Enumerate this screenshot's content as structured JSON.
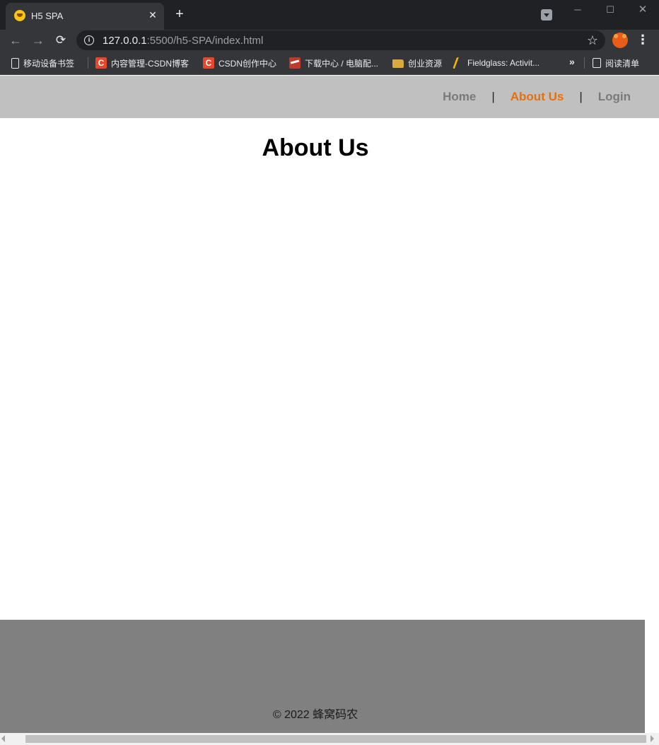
{
  "browser": {
    "tab_title": "H5 SPA",
    "tab_close": "✕",
    "new_tab": "+",
    "window_controls": {
      "minimize": "─",
      "maximize": "☐",
      "close": "✕"
    },
    "url_host": "127.0.0.1",
    "url_rest": ":5500/h5-SPA/index.html",
    "nav_icons": {
      "back": "←",
      "forward": "→",
      "reload": "⟳",
      "info": "i",
      "star": "☆",
      "menu": "⋮"
    },
    "bookmarks": [
      {
        "label": "移动设备书签",
        "icon": "device-icon"
      },
      {
        "label": "内容管理-CSDN博客",
        "icon": "csdn-icon"
      },
      {
        "label": "CSDN创作中心",
        "icon": "csdn-icon"
      },
      {
        "label": "下载中心 / 电脑配...",
        "icon": "download-site-icon"
      },
      {
        "label": "创业资源",
        "icon": "folder-icon"
      },
      {
        "label": "Fieldglass: Activit...",
        "icon": "fieldglass-icon"
      }
    ],
    "bookmarks_more": "»",
    "reading_list": "阅读清单",
    "csdn_letter": "C"
  },
  "page": {
    "nav": [
      {
        "label": "Home",
        "active": false
      },
      {
        "label": "About Us",
        "active": true
      },
      {
        "label": "Login",
        "active": false
      }
    ],
    "nav_divider": "|",
    "title": "About Us",
    "footer": "© 2022 蜂窝码农"
  },
  "colors": {
    "header_bg": "#c0c0c0",
    "active_link": "#e8700a",
    "inactive_link": "#7a7a7a",
    "footer_bg": "#808080"
  }
}
